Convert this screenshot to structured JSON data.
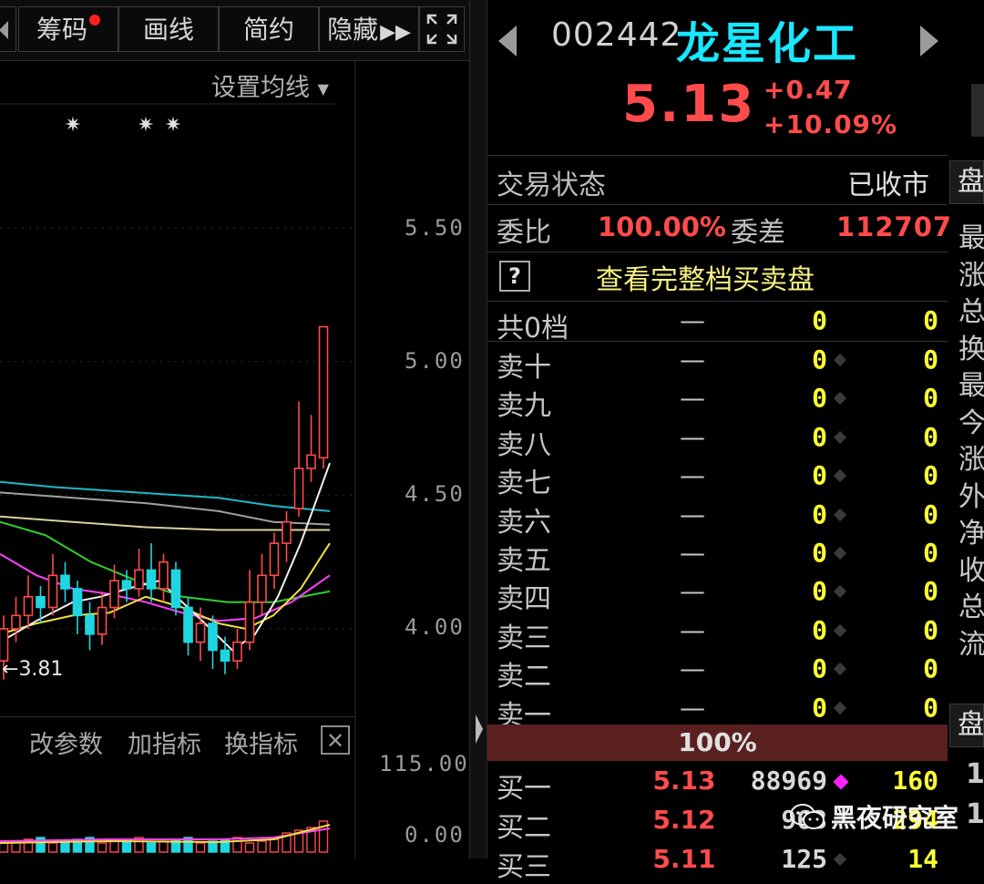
{
  "toolbar": {
    "buttons": [
      {
        "label": "筹码",
        "has_dot": true
      },
      {
        "label": "画线"
      },
      {
        "label": "简约"
      },
      {
        "label": "隐藏"
      }
    ],
    "fullscreen_icon": "expand-icon"
  },
  "chart": {
    "set_ma_label": "设置均线",
    "price_levels": [
      "5.50",
      "5.00",
      "4.50",
      "4.00"
    ],
    "low_annotation": "3.81",
    "volume_levels": [
      "115.00",
      "0.00"
    ],
    "candles": [
      {
        "o": 3.88,
        "c": 4.0,
        "h": 4.05,
        "l": 3.81
      },
      {
        "o": 4.0,
        "c": 4.05,
        "h": 4.12,
        "l": 3.95
      },
      {
        "o": 4.05,
        "c": 4.12,
        "h": 4.2,
        "l": 4.0
      },
      {
        "o": 4.12,
        "c": 4.08,
        "h": 4.16,
        "l": 4.02
      },
      {
        "o": 4.08,
        "c": 4.2,
        "h": 4.28,
        "l": 4.05
      },
      {
        "o": 4.2,
        "c": 4.15,
        "h": 4.25,
        "l": 4.1
      },
      {
        "o": 4.15,
        "c": 4.05,
        "h": 4.18,
        "l": 3.98
      },
      {
        "o": 4.05,
        "c": 3.98,
        "h": 4.1,
        "l": 3.92
      },
      {
        "o": 3.98,
        "c": 4.08,
        "h": 4.14,
        "l": 3.94
      },
      {
        "o": 4.08,
        "c": 4.18,
        "h": 4.24,
        "l": 4.04
      },
      {
        "o": 4.18,
        "c": 4.15,
        "h": 4.22,
        "l": 4.1
      },
      {
        "o": 4.15,
        "c": 4.22,
        "h": 4.3,
        "l": 4.12
      },
      {
        "o": 4.22,
        "c": 4.15,
        "h": 4.32,
        "l": 4.1
      },
      {
        "o": 4.15,
        "c": 4.25,
        "h": 4.28,
        "l": 4.1
      },
      {
        "o": 4.22,
        "c": 4.08,
        "h": 4.25,
        "l": 4.05
      },
      {
        "o": 4.08,
        "c": 3.95,
        "h": 4.12,
        "l": 3.9
      },
      {
        "o": 3.95,
        "c": 4.02,
        "h": 4.08,
        "l": 3.88
      },
      {
        "o": 4.02,
        "c": 3.92,
        "h": 4.05,
        "l": 3.85
      },
      {
        "o": 3.92,
        "c": 3.88,
        "h": 3.97,
        "l": 3.83
      },
      {
        "o": 3.88,
        "c": 3.95,
        "h": 4.0,
        "l": 3.85
      },
      {
        "o": 3.95,
        "c": 4.1,
        "h": 4.22,
        "l": 3.92
      },
      {
        "o": 4.1,
        "c": 4.2,
        "h": 4.28,
        "l": 4.05
      },
      {
        "o": 4.2,
        "c": 4.32,
        "h": 4.36,
        "l": 4.15
      },
      {
        "o": 4.32,
        "c": 4.4,
        "h": 4.44,
        "l": 4.25
      },
      {
        "o": 4.45,
        "c": 4.6,
        "h": 4.85,
        "l": 4.42
      },
      {
        "o": 4.6,
        "c": 4.65,
        "h": 4.8,
        "l": 4.55
      },
      {
        "o": 4.64,
        "c": 5.13,
        "h": 5.13,
        "l": 4.6
      }
    ]
  },
  "indicator_bar": {
    "items": [
      "改参数",
      "加指标",
      "换指标"
    ]
  },
  "quote": {
    "code": "002442",
    "name": "龙星化工",
    "price": "5.13",
    "change": "+0.47",
    "change_pct": "+10.09%"
  },
  "status": {
    "label": "交易状态",
    "value": "已收市"
  },
  "ratio": {
    "label": "委比",
    "value": "100.00%",
    "diff_label": "委差",
    "diff_value": "112707"
  },
  "full_book_link": "查看完整档买卖盘",
  "help_icon": "?",
  "book": {
    "total_row": {
      "label": "共0档",
      "price": "—",
      "vol": "0",
      "count": "0"
    },
    "asks": [
      {
        "label": "卖十",
        "price": "—",
        "vol": "0",
        "count": "0"
      },
      {
        "label": "卖九",
        "price": "—",
        "vol": "0",
        "count": "0"
      },
      {
        "label": "卖八",
        "price": "—",
        "vol": "0",
        "count": "0"
      },
      {
        "label": "卖七",
        "price": "—",
        "vol": "0",
        "count": "0"
      },
      {
        "label": "卖六",
        "price": "—",
        "vol": "0",
        "count": "0"
      },
      {
        "label": "卖五",
        "price": "—",
        "vol": "0",
        "count": "0"
      },
      {
        "label": "卖四",
        "price": "—",
        "vol": "0",
        "count": "0"
      },
      {
        "label": "卖三",
        "price": "—",
        "vol": "0",
        "count": "0"
      },
      {
        "label": "卖二",
        "price": "—",
        "vol": "0",
        "count": "0"
      },
      {
        "label": "卖一",
        "price": "—",
        "vol": "0",
        "count": "0"
      }
    ],
    "bid_pct": "100%",
    "bids": [
      {
        "label": "买一",
        "price": "5.13",
        "vol": "88969",
        "count": "160"
      },
      {
        "label": "买二",
        "price": "5.12",
        "vol": "963",
        "count": "294"
      },
      {
        "label": "买三",
        "price": "5.11",
        "vol": "125",
        "count": "14"
      }
    ]
  },
  "side_panel": {
    "tab_top": "盘",
    "items": [
      "最",
      "涨",
      "总",
      "换",
      "最",
      "今",
      "涨",
      "外",
      "净",
      "收",
      "总",
      "流"
    ],
    "tab_bottom": "盘",
    "bottom_items": [
      "1",
      "1"
    ]
  },
  "watermark": "黑夜研究室",
  "colors": {
    "up": "#ff4b4b",
    "down": "#1fd6e0",
    "name": "#19e6ff",
    "volume_qty": "#ffff33",
    "ma5": "#f2f2f2",
    "ma10": "#f0e040",
    "ma20": "#ff40ff",
    "ma30": "#30d030",
    "ma60": "#d8d0a0",
    "ma120": "#a0a0a0",
    "ma250": "#20b8c8"
  }
}
